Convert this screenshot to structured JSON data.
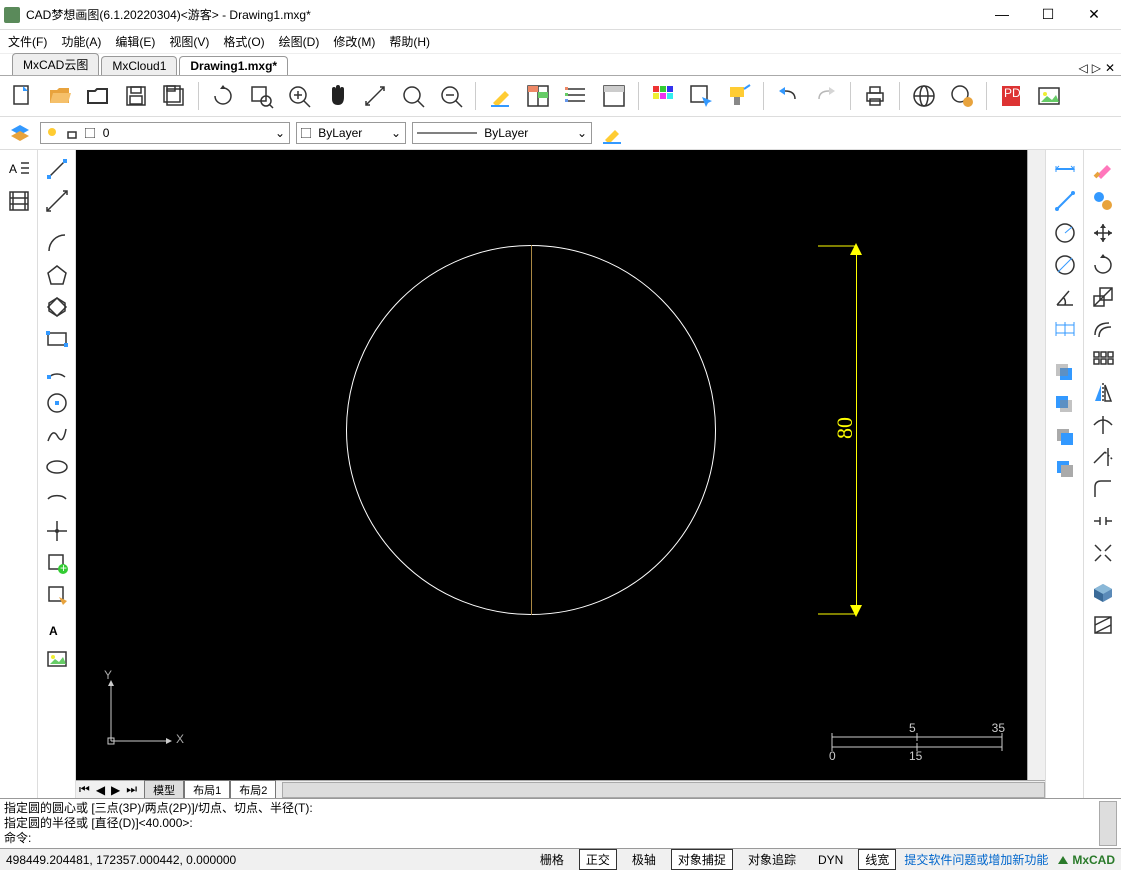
{
  "window": {
    "title": "CAD梦想画图(6.1.20220304)<游客> - Drawing1.mxg*"
  },
  "menu": {
    "file": "文件(F)",
    "func": "功能(A)",
    "edit": "编辑(E)",
    "view": "视图(V)",
    "format": "格式(O)",
    "draw": "绘图(D)",
    "modify": "修改(M)",
    "help": "帮助(H)"
  },
  "doctabs": [
    "MxCAD云图",
    "MxCloud1",
    "Drawing1.mxg*"
  ],
  "doctab_active": 2,
  "layer_panel": {
    "layer": "0",
    "color": "ByLayer",
    "ltype": "ByLayer"
  },
  "model_tabs": [
    "模型",
    "布局1",
    "布局2"
  ],
  "model_active": 0,
  "cmd": {
    "line1": "指定圆的圆心或 [三点(3P)/两点(2P)]/切点、切点、半径(T):",
    "line2": "指定圆的半径或 [直径(D)]<40.000>:",
    "prompt": "命令:"
  },
  "status": {
    "coords": "498449.204481, 172357.000442, 0.000000",
    "grid": "栅格",
    "ortho": "正交",
    "polar": "极轴",
    "osnap": "对象捕捉",
    "otrack": "对象追踪",
    "dyn": "DYN",
    "lw": "线宽",
    "feedback": "提交软件问题或增加新功能",
    "brand": "MxCAD"
  },
  "canvas": {
    "dim_value": "80",
    "axis_x": "X",
    "axis_y": "Y",
    "scale": {
      "l1": "5",
      "l2": "35",
      "l3": "0",
      "l4": "15"
    }
  }
}
